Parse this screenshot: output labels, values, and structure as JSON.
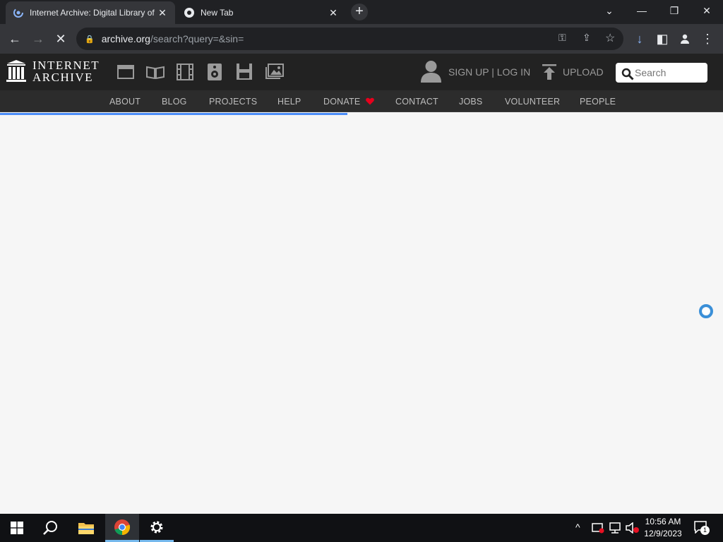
{
  "browser": {
    "tabs": [
      {
        "title": "Internet Archive: Digital Library of",
        "active": true
      },
      {
        "title": "New Tab",
        "active": false
      }
    ],
    "new_tab_label": "+",
    "url": {
      "domain": "archive.org",
      "path": "/search?query=&sin="
    }
  },
  "ia": {
    "logo_line1": "INTERNET",
    "logo_line2": "ARCHIVE",
    "media_icons": [
      "web-icon",
      "texts-icon",
      "video-icon",
      "audio-icon",
      "software-icon",
      "images-icon"
    ],
    "signup_login": "SIGN UP | LOG IN",
    "upload": "UPLOAD",
    "search_placeholder": "Search",
    "nav": [
      "ABOUT",
      "BLOG",
      "PROJECTS",
      "HELP",
      "DONATE",
      "CONTACT",
      "JOBS",
      "VOLUNTEER",
      "PEOPLE"
    ]
  },
  "loading": {
    "progress": 0.48
  },
  "taskbar": {
    "time": "10:56 AM",
    "date": "12/9/2023",
    "notification_count": "1"
  },
  "colors": {
    "accent": "#4b8df8",
    "donate_heart": "#e8001c",
    "spinner": "#3a8fd8"
  }
}
